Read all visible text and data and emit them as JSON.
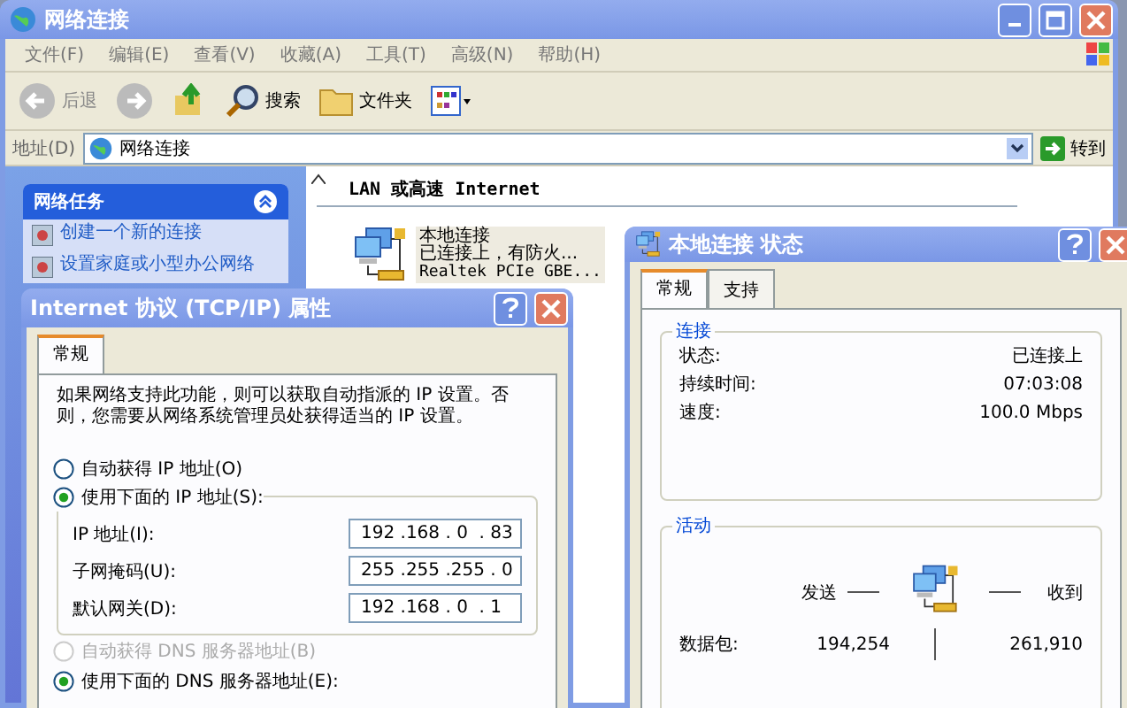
{
  "main_window": {
    "title": "网络连接",
    "menu": [
      "文件(F)",
      "编辑(E)",
      "查看(V)",
      "收藏(A)",
      "工具(T)",
      "高级(N)",
      "帮助(H)"
    ],
    "toolbar": [
      {
        "kind": "back",
        "label": "后退"
      },
      {
        "kind": "forward"
      },
      {
        "kind": "up"
      },
      {
        "kind": "search",
        "label": "搜索"
      },
      {
        "kind": "folders",
        "label": "文件夹"
      },
      {
        "kind": "views"
      }
    ],
    "address": {
      "label": "地址(D)",
      "value": "网络连接",
      "go": "转到"
    },
    "tasks": {
      "title": "网络任务",
      "items": [
        "创建一个新的连接",
        "设置家庭或小型办公网络"
      ]
    },
    "group_header": "LAN 或高速 Internet",
    "connection": {
      "name": "本地连接",
      "status": "已连接上，有防火...",
      "device": "Realtek PCIe GBE..."
    }
  },
  "tcpip_dialog": {
    "title": "Internet 协议 (TCP/IP) 属性",
    "tabs": [
      {
        "label": "常规",
        "selected": true
      }
    ],
    "description": "如果网络支持此功能，则可以获取自动指派的 IP 设置。否则，您需要从网络系统管理员处获得适当的 IP 设置。",
    "ip_radios": [
      {
        "label": "自动获得 IP 地址(O)",
        "selected": false,
        "disabled": false
      },
      {
        "label": "使用下面的 IP 地址(S):",
        "selected": true,
        "disabled": false
      }
    ],
    "fields": [
      {
        "label": "IP 地址(I):",
        "value": "192 .168 . 0  . 83"
      },
      {
        "label": "子网掩码(U):",
        "value": "255 .255 .255 . 0"
      },
      {
        "label": "默认网关(D):",
        "value": "192 .168 . 0  . 1"
      }
    ],
    "dns_radios": [
      {
        "label": "自动获得 DNS 服务器地址(B)",
        "selected": false,
        "disabled": true
      },
      {
        "label": "使用下面的 DNS 服务器地址(E):",
        "selected": true,
        "disabled": false
      }
    ]
  },
  "status_dialog": {
    "title": "本地连接 状态",
    "tabs": [
      {
        "label": "常规",
        "selected": true
      },
      {
        "label": "支持",
        "selected": false
      }
    ],
    "connection_group": {
      "title": "连接",
      "rows": [
        {
          "label": "状态:",
          "value": "已连接上"
        },
        {
          "label": "持续时间:",
          "value": "07:03:08"
        },
        {
          "label": "速度:",
          "value": "100.0 Mbps"
        }
      ]
    },
    "activity_group": {
      "title": "活动",
      "sent_label": "发送",
      "received_label": "收到",
      "packets_label": "数据包:",
      "sent": "194,254",
      "received": "261,910"
    }
  }
}
